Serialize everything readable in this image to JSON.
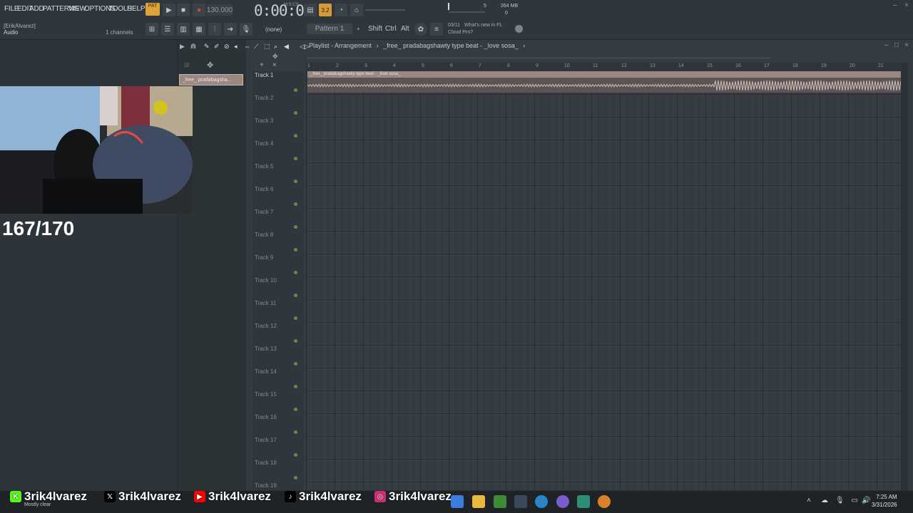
{
  "menu": [
    "FILE",
    "EDIT",
    "ADD",
    "PATTERNS",
    "VIEW",
    "OPTIONS",
    "TOOLS",
    "HELP"
  ],
  "transport": {
    "mode": "PAT",
    "tempo": "130.000",
    "time": "0:00:00",
    "time_unit": "M:S:CS"
  },
  "pattern": {
    "label": "Pattern 1",
    "none_label": "(none)"
  },
  "keys": [
    "Shift",
    "Ctrl",
    "Alt"
  ],
  "news": {
    "date": "03/11",
    "text_line1": "What's new in FL",
    "text_line2": "Cloud Pro?"
  },
  "memory": {
    "cpu": "5",
    "ram": "264 MB",
    "poly": "0"
  },
  "user": {
    "name": "[ErikAlvarez]",
    "sub": "Audio",
    "channels": "1 channels"
  },
  "browser": {
    "clip": "_free_ pradabagsha..."
  },
  "overlay": {
    "counter": "167/170"
  },
  "playlist": {
    "title": "Playlist - Arrangement",
    "crumb_sep": "›",
    "song": "_free_ pradabagshawty type beat - _love sosa_",
    "clip_label": "_free_ pradabagshawty type beat - _love sosa_",
    "ruler": [
      "1",
      "2",
      "3",
      "4",
      "5",
      "6",
      "7",
      "8",
      "9",
      "10",
      "11",
      "12",
      "13",
      "14",
      "15",
      "16",
      "17",
      "18",
      "19",
      "20",
      "21"
    ],
    "tracks": [
      "Track 1",
      "Track 2",
      "Track 3",
      "Track 4",
      "Track 5",
      "Track 6",
      "Track 7",
      "Track 8",
      "Track 9",
      "Track 10",
      "Track 11",
      "Track 12",
      "Track 13",
      "Track 14",
      "Track 15",
      "Track 16",
      "Track 17",
      "Track 18",
      "Track 19"
    ]
  },
  "socials": [
    {
      "icon": "kick-icon",
      "glyph": "K",
      "color": "#53fc18",
      "handle": "3rik4lvarez"
    },
    {
      "icon": "x-icon",
      "glyph": "𝕏",
      "color": "#000000",
      "handle": "3rik4lvarez"
    },
    {
      "icon": "youtube-icon",
      "glyph": "▶",
      "color": "#ff0000",
      "handle": "3rik4lvarez"
    },
    {
      "icon": "tiktok-icon",
      "glyph": "♪",
      "color": "#000000",
      "handle": "3rik4lvarez"
    },
    {
      "icon": "instagram-icon",
      "glyph": "◎",
      "color": "#d62976",
      "handle": "3rik4lvarez"
    }
  ],
  "taskbar": {
    "weather": "Mostly clear",
    "time": "7:25 AM",
    "date": "3/31/2026"
  }
}
